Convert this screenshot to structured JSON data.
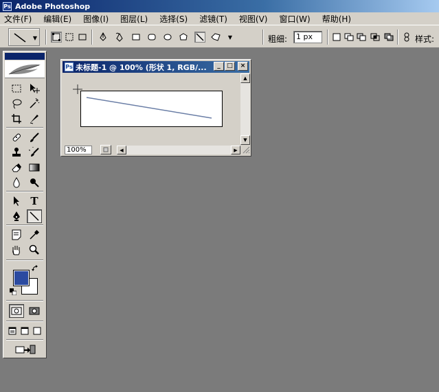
{
  "app": {
    "title": "Adobe Photoshop"
  },
  "menu": {
    "items": [
      "文件(F)",
      "编辑(E)",
      "图像(I)",
      "图层(L)",
      "选择(S)",
      "滤镜(T)",
      "视图(V)",
      "窗口(W)",
      "帮助(H)"
    ]
  },
  "options": {
    "weight_label": "粗细:",
    "weight_value": "1 px",
    "style_label": "样式:"
  },
  "document": {
    "title": "未标题-1 @ 100% (形状 1, RGB/...",
    "zoom": "100%",
    "min_glyph": "_",
    "max_glyph": "□",
    "close_glyph": "×"
  },
  "colors": {
    "foreground": "#2b4aa0",
    "background": "#ffffff",
    "workspace": "#7b7b7b",
    "chrome": "#d4d0c8",
    "titlebar": "#0a246a"
  },
  "icons": {
    "toolbox": [
      "marquee-icon",
      "move-icon",
      "lasso-icon",
      "magic-wand-icon",
      "crop-icon",
      "slice-icon",
      "healing-brush-icon",
      "brush-icon",
      "clone-stamp-icon",
      "history-brush-icon",
      "eraser-icon",
      "gradient-icon",
      "blur-icon",
      "dodge-icon",
      "path-select-icon",
      "type-icon",
      "pen-icon",
      "line-icon",
      "notes-icon",
      "eyedropper-icon",
      "hand-icon",
      "zoom-icon"
    ]
  }
}
